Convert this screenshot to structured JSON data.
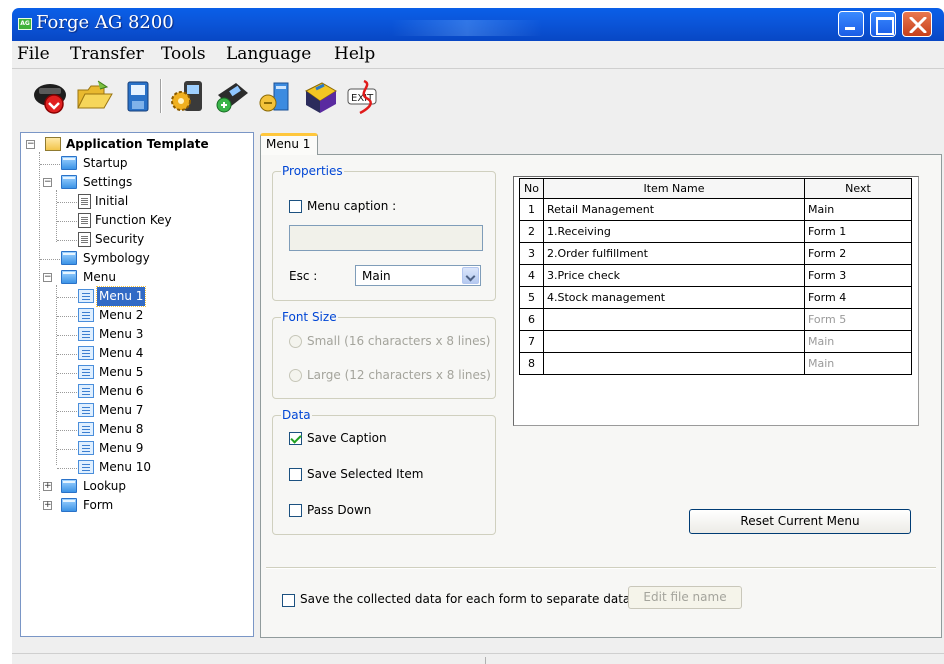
{
  "window": {
    "title": "Forge AG 8200",
    "app_icon_text": "AG"
  },
  "menubar": [
    "File",
    "Transfer",
    "Tools",
    "Language",
    "Help"
  ],
  "toolbar": {
    "tools": [
      {
        "name": "cancel-tool",
        "icon": "red-stop-icon"
      },
      {
        "name": "open-tool",
        "icon": "open-folder-icon"
      },
      {
        "name": "save-tool",
        "icon": "save-disk-icon"
      },
      {
        "name": "settings-tool",
        "icon": "terminal-settings-icon"
      },
      {
        "name": "download-tool",
        "icon": "terminal-download-icon"
      },
      {
        "name": "database-tool",
        "icon": "database-icon"
      },
      {
        "name": "help-tool",
        "icon": "help-book-icon"
      },
      {
        "name": "exit-tool",
        "icon": "exit-icon"
      }
    ],
    "exit_label": "EXIT"
  },
  "tree": {
    "root": "Application Template",
    "startup": "Startup",
    "settings": "Settings",
    "settings_children": [
      "Initial",
      "Function Key",
      "Security"
    ],
    "symbology": "Symbology",
    "menu": "Menu",
    "menu_children": [
      "Menu 1",
      "Menu 2",
      "Menu 3",
      "Menu 4",
      "Menu 5",
      "Menu 6",
      "Menu 7",
      "Menu 8",
      "Menu 9",
      "Menu 10"
    ],
    "selected": "Menu 1",
    "lookup": "Lookup",
    "form": "Form"
  },
  "tab": {
    "label": "Menu 1"
  },
  "properties": {
    "title": "Properties",
    "menu_caption_label": "Menu caption :",
    "menu_caption_checked": false,
    "menu_caption_value": "",
    "esc_label": "Esc :",
    "esc_value": "Main"
  },
  "font_size": {
    "title": "Font Size",
    "small_label": "Small (16 characters x 8 lines)",
    "large_label": "Large (12 characters x 8 lines)"
  },
  "data_group": {
    "title": "Data",
    "save_caption": {
      "label": "Save Caption",
      "checked": true
    },
    "save_selected_item": {
      "label": "Save Selected Item",
      "checked": false
    },
    "pass_down": {
      "label": "Pass Down",
      "checked": false
    }
  },
  "grid": {
    "headers": [
      "No",
      "Item Name",
      "Next"
    ],
    "rows": [
      {
        "no": "1",
        "name": "Retail Management",
        "next": "Main",
        "next_dim": false
      },
      {
        "no": "2",
        "name": "1.Receiving",
        "next": "Form 1",
        "next_dim": false
      },
      {
        "no": "3",
        "name": "2.Order fulfillment",
        "next": "Form 2",
        "next_dim": false
      },
      {
        "no": "4",
        "name": "3.Price check",
        "next": "Form 3",
        "next_dim": false
      },
      {
        "no": "5",
        "name": "4.Stock management",
        "next": "Form 4",
        "next_dim": false
      },
      {
        "no": "6",
        "name": "",
        "next": "Form 5",
        "next_dim": true
      },
      {
        "no": "7",
        "name": "",
        "next": "Main",
        "next_dim": true
      },
      {
        "no": "8",
        "name": "",
        "next": "Main",
        "next_dim": true
      }
    ]
  },
  "reset_button": "Reset Current Menu",
  "footer": {
    "separate_files_label": "Save the collected data for each form to separate data files",
    "separate_files_checked": false,
    "edit_file_name_button": "Edit file name"
  },
  "colors": {
    "titlebar": "#0b55d9",
    "group_title": "#0046d5",
    "selection": "#316ac5",
    "tab_accent": "#ffc73c"
  }
}
